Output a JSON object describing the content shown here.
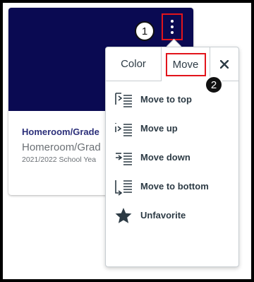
{
  "card": {
    "title": "Homeroom/Grade",
    "subtitle": "Homeroom/Grad",
    "term": "2021/2022 School Yea",
    "hero_color": "#0a0a52"
  },
  "callouts": {
    "one": "1",
    "two": "2"
  },
  "menu": {
    "tabs": {
      "color": "Color",
      "move": "Move"
    },
    "close_icon": "close-icon",
    "items": [
      {
        "label": "Move to top",
        "icon": "move-to-top-icon"
      },
      {
        "label": "Move up",
        "icon": "move-up-icon"
      },
      {
        "label": "Move down",
        "icon": "move-down-icon"
      },
      {
        "label": "Move to bottom",
        "icon": "move-to-bottom-icon"
      },
      {
        "label": "Unfavorite",
        "icon": "star-icon"
      }
    ]
  },
  "colors": {
    "highlight": "#e2141b",
    "text": "#2d3b45",
    "title": "#2b2f7a"
  }
}
